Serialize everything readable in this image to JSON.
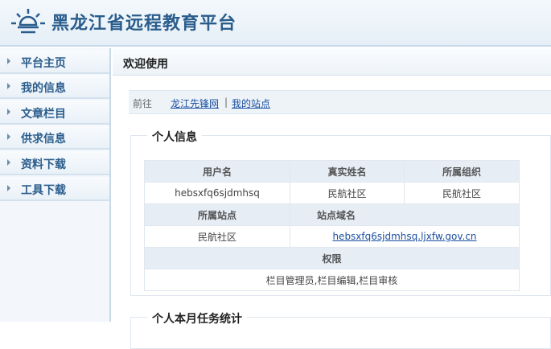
{
  "header": {
    "title": "黑龙江省远程教育平台",
    "logo_icon": "sun-logo-icon"
  },
  "sidebar": {
    "items": [
      {
        "label": "平台主页"
      },
      {
        "label": "我的信息"
      },
      {
        "label": "文章栏目"
      },
      {
        "label": "供求信息"
      },
      {
        "label": "资料下载"
      },
      {
        "label": "工具下载"
      }
    ]
  },
  "main": {
    "welcome": "欢迎使用",
    "crumb": {
      "goto": "前往",
      "link1": "龙江先锋网",
      "sep": "|",
      "link2": "我的站点"
    },
    "personal_info": {
      "legend": "个人信息",
      "headers1": [
        "用户名",
        "真实姓名",
        "所属组织"
      ],
      "values1": [
        "hebsxfq6sjdmhsq",
        "民航社区",
        "民航社区"
      ],
      "headers2": [
        "所属站点",
        "站点域名"
      ],
      "values2": [
        "民航社区",
        "hebsxfq6sjdmhsq.ljxfw.gov.cn"
      ],
      "perm_header": "权限",
      "perm_value": "栏目管理员,栏目编辑,栏目审核"
    },
    "task_stats": {
      "legend": "个人本月任务统计"
    }
  },
  "colors": {
    "title": "#2a5d8c",
    "link": "#1a4fa0",
    "header_bg": "#e6eff7"
  }
}
